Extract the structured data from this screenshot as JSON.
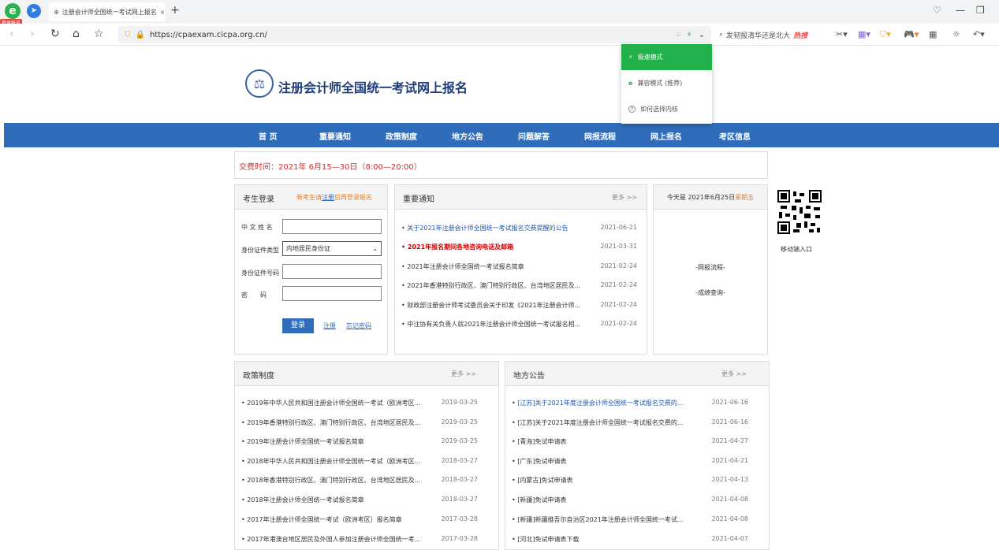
{
  "browser": {
    "badge": "登录帐号",
    "tab_title": "注册会计师全国统一考试网上报名",
    "tab_close": "×",
    "new_tab": "+",
    "url": "https://cpaexam.cicpa.org.cn/",
    "search_text": "发韧报清华还是北大",
    "search_hot": "热搜",
    "accent": "#22b04b"
  },
  "dropdown": {
    "items": [
      {
        "label": "极速模式",
        "icon": "bolt-icon"
      },
      {
        "label": "兼容模式 (推荐)",
        "icon": "ie-icon"
      },
      {
        "label": "如何选择内核",
        "icon": "question-icon"
      }
    ]
  },
  "site": {
    "title": "注册会计师全国统一考试网上报名",
    "nav": [
      "首 页",
      "重要通知",
      "政策制度",
      "地方公告",
      "问题解答",
      "网报流程",
      "网上报名",
      "考区信息"
    ],
    "notice": "交费时间：2021年 6月15—30日（8:00—20:00）"
  },
  "login": {
    "title": "考生登录",
    "promo_pre": "新考生请",
    "promo_link": "注册",
    "promo_post": "后再登录报名",
    "name_label": "中 文 姓 名",
    "idtype_label": "身份证件类型",
    "idtype_value": "内地居民身份证",
    "idno_label": "身份证件号码",
    "pwd_label": "密　　码",
    "login_button": "登录",
    "register_link": "注册",
    "forgot_link": "忘记密码"
  },
  "important": {
    "title": "重要通知",
    "more": "更多 >>",
    "items": [
      {
        "text": "关于2021年注册会计师全国统一考试报名交费提醒的公告",
        "date": "2021-06-21"
      },
      {
        "text": "2021年报名期间各地咨询电话及邮箱",
        "date": "2021-03-31"
      },
      {
        "text": "2021年注册会计师全国统一考试报名简章",
        "date": "2021-02-24"
      },
      {
        "text": "2021年香港特别行政区、澳门特别行政区、台湾地区居民及...",
        "date": "2021-02-24"
      },
      {
        "text": "财政部注册会计师考试委员会关于印发《2021年注册会计师...",
        "date": "2021-02-24"
      },
      {
        "text": "中注协有关负责人就2021年注册会计师全国统一考试报名相...",
        "date": "2021-02-24"
      }
    ]
  },
  "today": {
    "prefix": "今天是 2021年6月25日",
    "weekday": "星期五",
    "links": [
      "-网报流程-",
      "-成绩查询-"
    ]
  },
  "qr": {
    "label": "移动端入口"
  },
  "policy": {
    "title": "政策制度",
    "more": "更多 >>",
    "items": [
      {
        "text": "2019年中华人民共和国注册会计师全国统一考试（欧洲考区...",
        "date": "2019-03-25"
      },
      {
        "text": "2019年香港特别行政区、澳门特别行政区、台湾地区居民及...",
        "date": "2019-03-25"
      },
      {
        "text": "2019年注册会计师全国统一考试报名简章",
        "date": "2019-03-25"
      },
      {
        "text": "2018年中华人民共和国注册会计师全国统一考试（欧洲考区...",
        "date": "2018-03-27"
      },
      {
        "text": "2018年香港特别行政区、澳门特别行政区、台湾地区居民及...",
        "date": "2018-03-27"
      },
      {
        "text": "2018年注册会计师全国统一考试报名简章",
        "date": "2018-03-27"
      },
      {
        "text": "2017年注册会计师全国统一考试（欧洲考区）报名简章",
        "date": "2017-03-28"
      },
      {
        "text": "2017年港澳台地区居民及外国人参加注册会计师全国统一考...",
        "date": "2017-03-28"
      }
    ]
  },
  "local": {
    "title": "地方公告",
    "more": "更多 >>",
    "items": [
      {
        "text": "[江苏]关于2021年度注册会计师全国统一考试报名交费的...",
        "date": "2021-06-16"
      },
      {
        "text": "[江苏]关于2021年度注册会计师全国统一考试报名交费的...",
        "date": "2021-06-16"
      },
      {
        "text": "[青海]免试申请表",
        "date": "2021-04-27"
      },
      {
        "text": "[广东]免试申请表",
        "date": "2021-04-21"
      },
      {
        "text": "[内蒙古]免试申请表",
        "date": "2021-04-13"
      },
      {
        "text": "[新疆]免试申请表",
        "date": "2021-04-08"
      },
      {
        "text": "[新疆]新疆维吾尔自治区2021年注册会计师全国统一考试...",
        "date": "2021-04-08"
      },
      {
        "text": "[河北]免试申请表下载",
        "date": "2021-04-07"
      }
    ]
  }
}
